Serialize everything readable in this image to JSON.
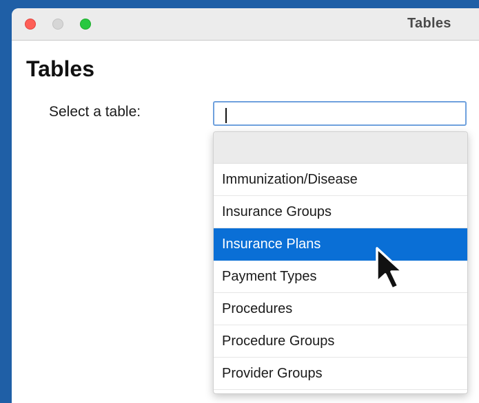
{
  "window": {
    "title": "Tables"
  },
  "page": {
    "heading": "Tables"
  },
  "table_select": {
    "label": "Select a table:",
    "value": "",
    "options": [
      "Immunization/Disease",
      "Insurance Groups",
      "Insurance Plans",
      "Payment Types",
      "Procedures",
      "Procedure Groups",
      "Provider Groups"
    ],
    "highlighted": "Insurance Plans"
  },
  "colors": {
    "desktop": "#1f5fa6",
    "selection": "#0a6fd6",
    "input_focus_border": "#6ea0dd"
  },
  "icons": {
    "cursor": "arrow-pointer-icon"
  }
}
